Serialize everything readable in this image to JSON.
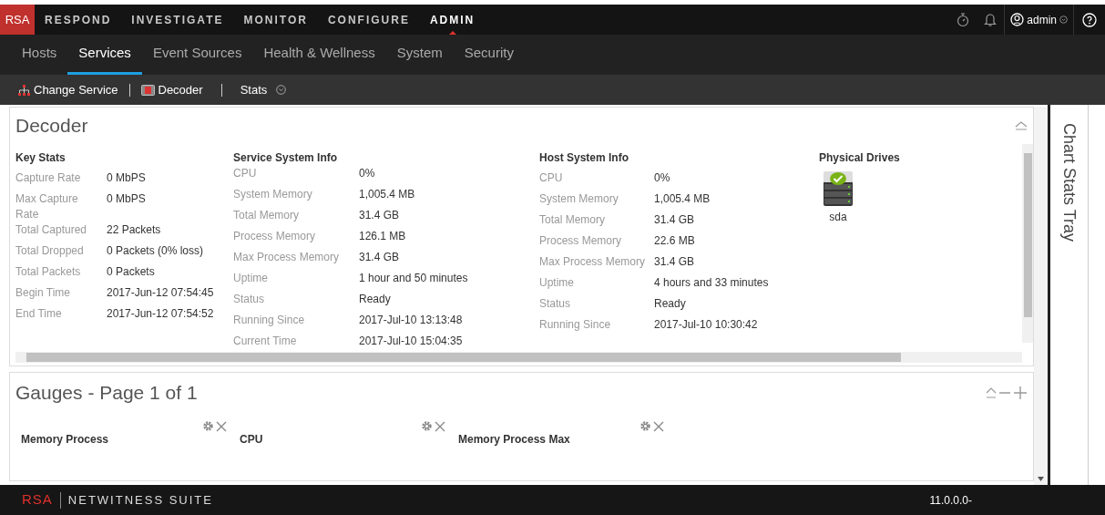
{
  "top_nav": {
    "logo": "RSA",
    "items": [
      {
        "label": "RESPOND",
        "selected": false
      },
      {
        "label": "INVESTIGATE",
        "selected": false
      },
      {
        "label": "MONITOR",
        "selected": false
      },
      {
        "label": "CONFIGURE",
        "selected": false
      },
      {
        "label": "ADMIN",
        "selected": true
      }
    ],
    "user": "admin"
  },
  "sub_tabs": [
    {
      "label": "Hosts",
      "selected": false
    },
    {
      "label": "Services",
      "selected": true
    },
    {
      "label": "Event Sources",
      "selected": false
    },
    {
      "label": "Health & Wellness",
      "selected": false
    },
    {
      "label": "System",
      "selected": false
    },
    {
      "label": "Security",
      "selected": false
    }
  ],
  "toolbar": {
    "change_service": "Change Service",
    "service": "Decoder",
    "view": "Stats"
  },
  "decoder_panel": {
    "title": "Decoder",
    "sections": [
      {
        "title": "Key Stats",
        "rows": [
          {
            "label": "Capture Rate",
            "value": "0 MbPS"
          },
          {
            "label": "Max Capture Rate",
            "value": "0 MbPS"
          },
          {
            "label": "Total Captured",
            "value": "22 Packets"
          },
          {
            "label": "Total Dropped",
            "value": "0 Packets (0% loss)"
          },
          {
            "label": "Total Packets",
            "value": "0 Packets"
          },
          {
            "label": "Begin Time",
            "value": "2017-Jun-12 07:54:45"
          },
          {
            "label": "End Time",
            "value": "2017-Jun-12 07:54:52"
          }
        ]
      },
      {
        "title": "Service System Info",
        "rows": [
          {
            "label": "CPU",
            "value": "0%"
          },
          {
            "label": "System Memory",
            "value": "1,005.4 MB"
          },
          {
            "label": "Total Memory",
            "value": "31.4 GB"
          },
          {
            "label": "Process Memory",
            "value": "126.1 MB"
          },
          {
            "label": "Max Process Memory",
            "value": "31.4 GB"
          },
          {
            "label": "Uptime",
            "value": "1 hour and 50 minutes"
          },
          {
            "label": "Status",
            "value": "Ready"
          },
          {
            "label": "Running Since",
            "value": "2017-Jul-10 13:13:48"
          },
          {
            "label": "Current Time",
            "value": "2017-Jul-10 15:04:35"
          }
        ]
      },
      {
        "title": "Host System Info",
        "rows": [
          {
            "label": "CPU",
            "value": "0%"
          },
          {
            "label": "System Memory",
            "value": "1,005.4 MB"
          },
          {
            "label": "Total Memory",
            "value": "31.4 GB"
          },
          {
            "label": "Process Memory",
            "value": "22.6 MB"
          },
          {
            "label": "Max Process Memory",
            "value": "31.4 GB"
          },
          {
            "label": "Uptime",
            "value": "4 hours and 33 minutes"
          },
          {
            "label": "Status",
            "value": "Ready"
          },
          {
            "label": "Running Since",
            "value": "2017-Jul-10 10:30:42"
          }
        ]
      }
    ],
    "physical_drives": {
      "title": "Physical Drives",
      "drives": [
        {
          "name": "sda"
        }
      ]
    }
  },
  "gauges_panel": {
    "title": "Gauges - Page 1 of 1",
    "gauges": [
      {
        "title": "Memory Process"
      },
      {
        "title": "CPU"
      },
      {
        "title": "Memory Process Max"
      }
    ]
  },
  "side_tray": {
    "title": "Chart Stats Tray"
  },
  "footer": {
    "logo": "RSA",
    "product": "NETWITNESS SUITE",
    "version": "11.0.0.0-"
  }
}
